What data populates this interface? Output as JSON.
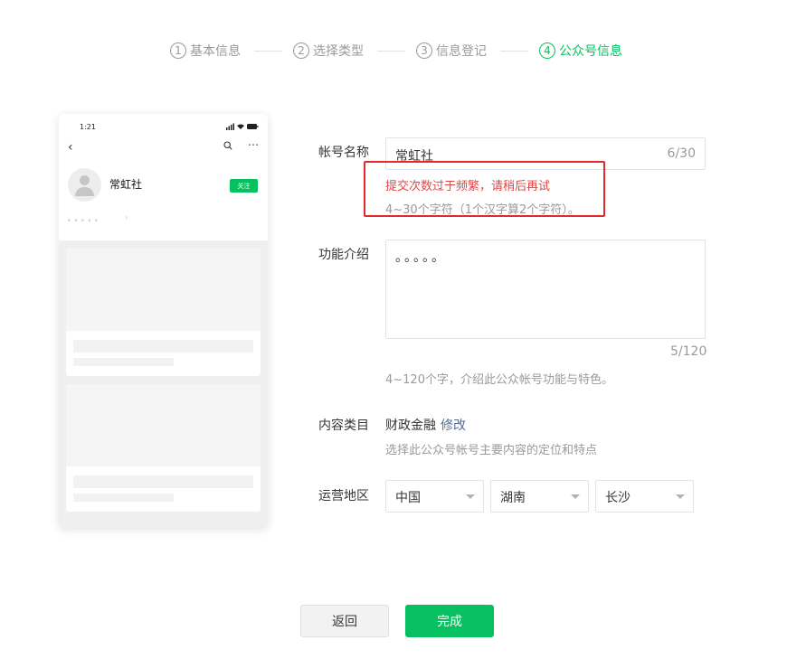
{
  "steps": [
    {
      "num": "1",
      "label": "基本信息"
    },
    {
      "num": "2",
      "label": "选择类型"
    },
    {
      "num": "3",
      "label": "信息登记"
    },
    {
      "num": "4",
      "label": "公众号信息"
    }
  ],
  "colors": {
    "accent": "#07c160",
    "error": "#e64340",
    "error_box": "#e02b2b",
    "link": "#576b95",
    "muted": "#9a9a9a"
  },
  "preview": {
    "status_time": "1:21",
    "account_name": "常虹社",
    "follow_label": "关注",
    "intro": "。。。。。",
    "icons": [
      "back-arrow-icon",
      "search-icon",
      "more-icon",
      "avatar-placeholder-icon"
    ]
  },
  "form": {
    "name": {
      "label": "帐号名称",
      "value": "常虹社",
      "count": "6/30",
      "error": "提交次数过于频繁，请稍后再试",
      "hint": "4~30个字符（1个汉字算2个字符）。"
    },
    "intro": {
      "label": "功能介绍",
      "value": "。。。。。",
      "count": "5/120",
      "hint": "4~120个字，介绍此公众帐号功能与特色。"
    },
    "category": {
      "label": "内容类目",
      "value": "财政金融",
      "edit": "修改",
      "hint": "选择此公众号帐号主要内容的定位和特点"
    },
    "region": {
      "label": "运营地区",
      "country": "中国",
      "province": "湖南",
      "city": "长沙"
    }
  },
  "buttons": {
    "back": "返回",
    "done": "完成"
  }
}
